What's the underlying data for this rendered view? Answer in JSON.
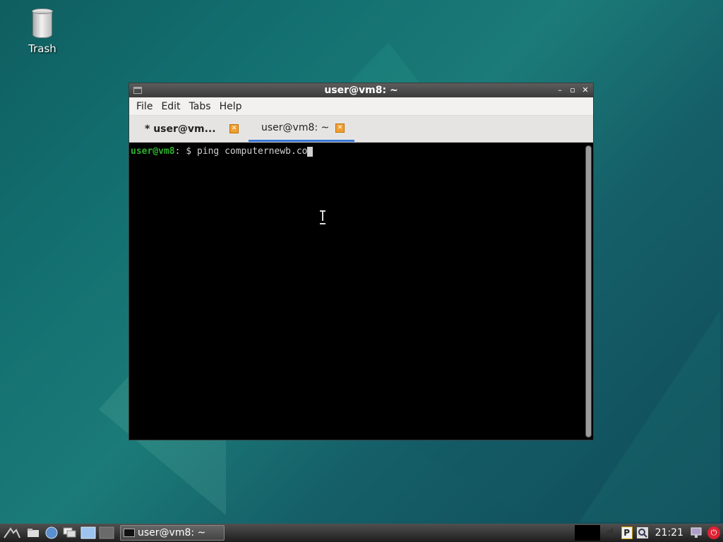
{
  "desktop": {
    "trash_label": "Trash"
  },
  "window": {
    "title": "user@vm8: ~",
    "minimize_glyph": "–",
    "maximize_glyph": "▫",
    "close_glyph": "✕"
  },
  "menu": {
    "items": [
      "File",
      "Edit",
      "Tabs",
      "Help"
    ]
  },
  "tabs": [
    {
      "label": "* user@vm...",
      "close": "✕"
    },
    {
      "label": "user@vm8: ~",
      "close": "✕"
    }
  ],
  "terminal": {
    "prompt_user": "user@vm8",
    "prompt_rest": ": $ ",
    "command": "ping computernewb.co"
  },
  "taskbar": {
    "task_label": "user@vm8: ~",
    "clock": "21:21",
    "tray_p": "P"
  },
  "colors": {
    "prompt_green": "#2fb12f",
    "active_tab_underline": "#3a79d8",
    "tab_close": "#f0a030"
  }
}
